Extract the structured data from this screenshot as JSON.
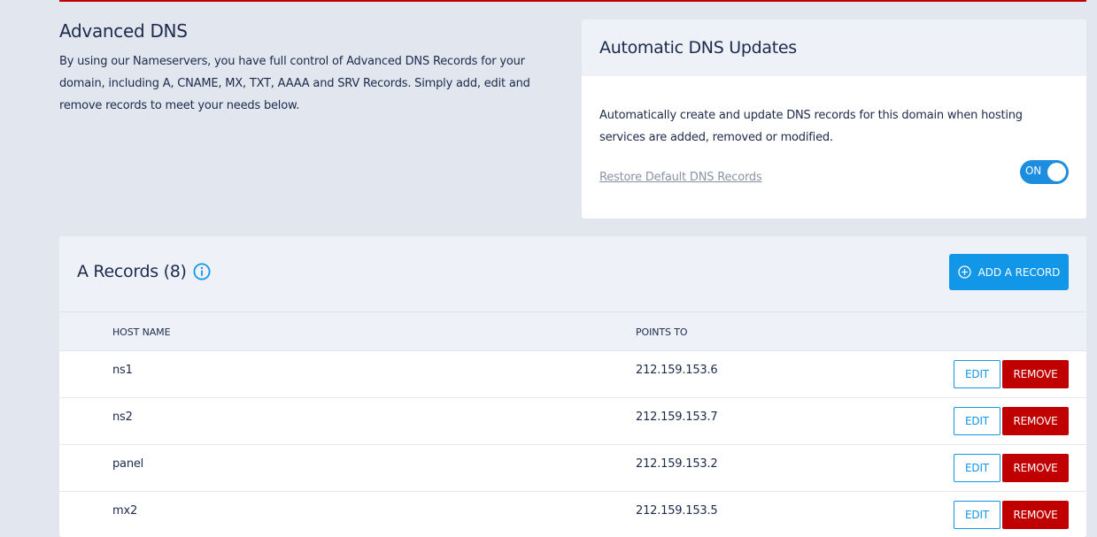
{
  "intro": {
    "title": "Advanced DNS",
    "description": "By using our Nameservers, you have full control of Advanced DNS Records for your domain, including A, CNAME, MX, TXT, AAAA and SRV Records. Simply add, edit and remove records to meet your needs below."
  },
  "auto_dns": {
    "title": "Automatic DNS Updates",
    "description": "Automatically create and update DNS records for this domain when hosting services are added, removed or modified.",
    "restore_link": "Restore Default DNS Records",
    "toggle_label": "ON",
    "toggle_on": true
  },
  "records": {
    "title": "A Records (8)",
    "add_button": "ADD A RECORD",
    "columns": [
      "HOST NAME",
      "POINTS TO"
    ],
    "edit_label": "EDIT",
    "remove_label": "REMOVE",
    "rows": [
      {
        "host": "ns1",
        "points": "212.159.153.6"
      },
      {
        "host": "ns2",
        "points": "212.159.153.7"
      },
      {
        "host": "panel",
        "points": "212.159.153.2"
      },
      {
        "host": "mx2",
        "points": "212.159.153.5"
      }
    ]
  },
  "colors": {
    "accent": "#1296e8",
    "danger": "#c00000",
    "background": "#e1e6ef"
  }
}
